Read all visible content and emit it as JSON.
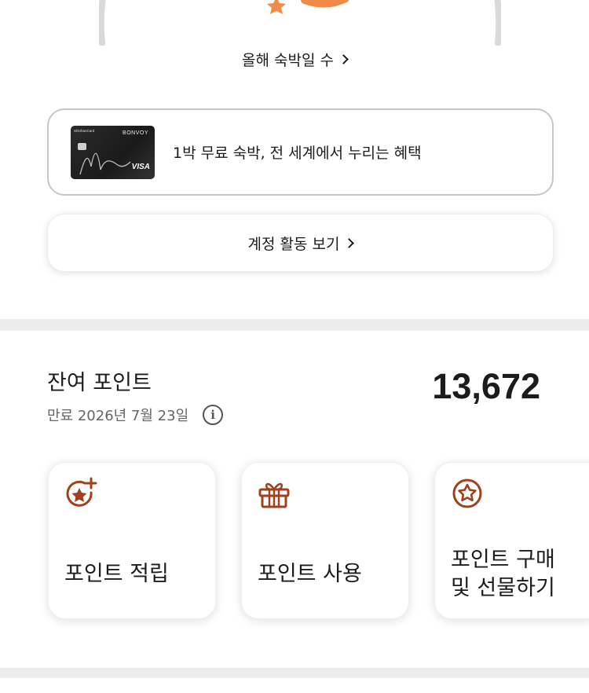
{
  "top": {
    "nights_link_label": "올해 숙박일 수",
    "promo_text": "1박 무료 숙박, 전 세계에서 누리는 혜택",
    "card": {
      "issuer_text": "ShinhanCard",
      "brand_text": "BONVOY",
      "network_text": "VISA"
    },
    "activity_label": "계정 활동 보기"
  },
  "points": {
    "title": "잔여 포인트",
    "value": "13,672",
    "expiry": "만료 2026년 7월 23일",
    "info_icon_glyph": "i"
  },
  "tiles": [
    {
      "label_line1": "포인트 적립",
      "label_line2": "",
      "icon": "star-plus-icon"
    },
    {
      "label_line1": "포인트 사용",
      "label_line2": "",
      "icon": "gift-icon"
    },
    {
      "label_line1": "포인트 구매",
      "label_line2": "및 선물하기",
      "icon": "star-circle-icon"
    }
  ],
  "colors": {
    "accent": "#a0401c",
    "orange": "#f08a4b",
    "divider": "#ececec",
    "arc": "#d9d9d9"
  }
}
